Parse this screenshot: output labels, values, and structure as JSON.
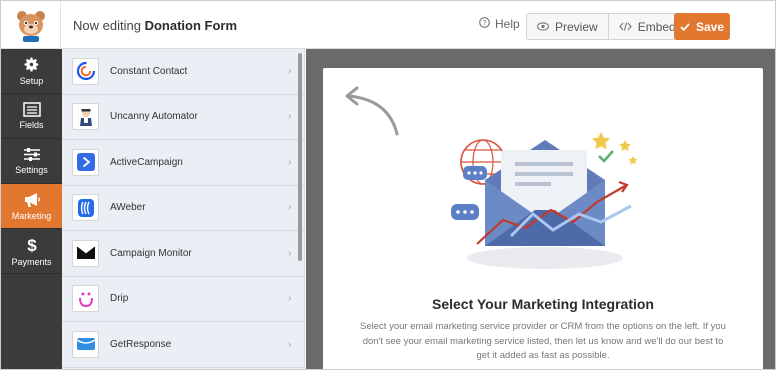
{
  "header": {
    "editing_prefix": "Now editing",
    "form_name": "Donation Form",
    "help_label": "Help",
    "preview_label": "Preview",
    "embed_label": "Embed",
    "save_label": "Save"
  },
  "nav": {
    "items": [
      {
        "label": "Setup",
        "icon": "gear-icon"
      },
      {
        "label": "Fields",
        "icon": "fields-list-icon"
      },
      {
        "label": "Settings",
        "icon": "sliders-icon"
      },
      {
        "label": "Marketing",
        "icon": "megaphone-icon"
      },
      {
        "label": "Payments",
        "icon": "dollar-icon"
      }
    ],
    "active": "Marketing"
  },
  "providers": [
    {
      "name": "Constant Contact",
      "icon": "constant-contact-icon"
    },
    {
      "name": "Uncanny Automator",
      "icon": "uncanny-automator-icon"
    },
    {
      "name": "ActiveCampaign",
      "icon": "activecampaign-icon"
    },
    {
      "name": "AWeber",
      "icon": "aweber-icon"
    },
    {
      "name": "Campaign Monitor",
      "icon": "campaign-monitor-icon"
    },
    {
      "name": "Drip",
      "icon": "drip-icon"
    },
    {
      "name": "GetResponse",
      "icon": "getresponse-icon"
    }
  ],
  "main": {
    "title": "Select Your Marketing Integration",
    "description": "Select your email marketing service provider or CRM from the options on the left. If you don't see your email marketing service listed, then let us know and we'll do our best to get it added as fast as possible."
  },
  "colors": {
    "accent": "#e27730",
    "nav_bg": "#3b3b3b",
    "list_bg": "#ebeef4",
    "preview_bg": "#6a6a6a"
  }
}
